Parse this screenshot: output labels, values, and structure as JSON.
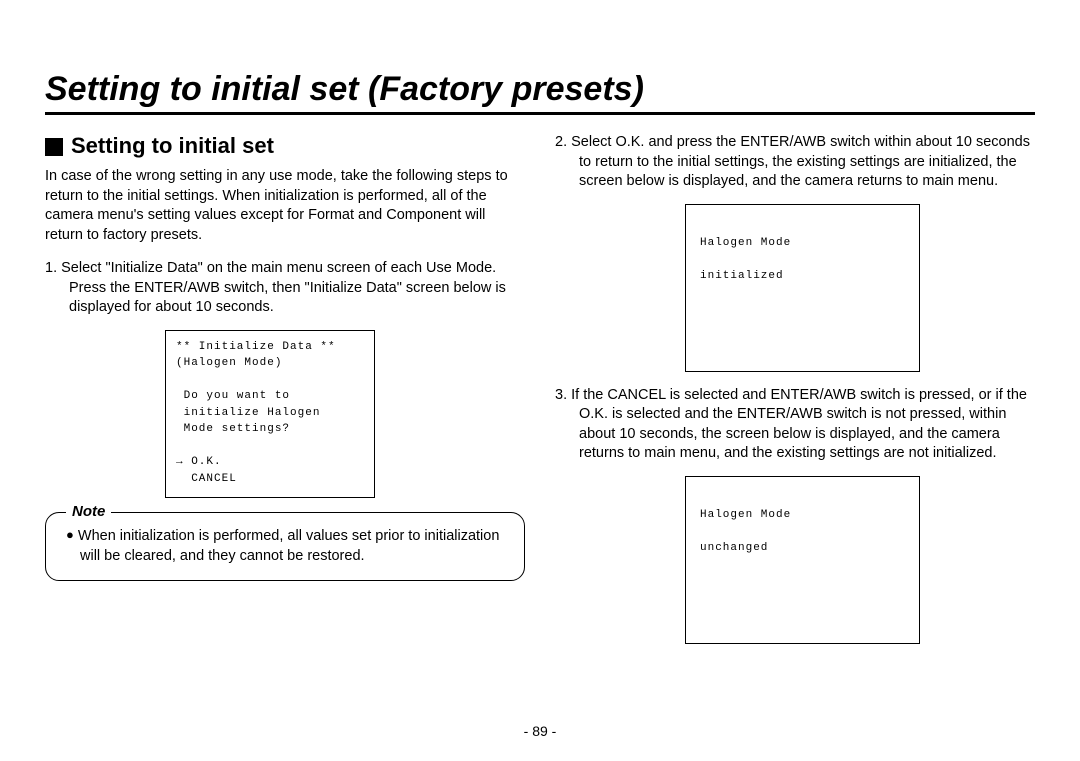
{
  "title": "Setting to initial set (Factory presets)",
  "left": {
    "heading": "Setting to initial set",
    "intro": "In case of the wrong setting in any use mode, take the following steps to return to the initial settings.\nWhen initialization is performed, all of the camera menu's setting values except for Format and Component will return to factory presets.",
    "step1_num": "1.",
    "step1": "Select \"Initialize Data\" on the main menu screen of each Use Mode.\nPress the ENTER/AWB switch, then \"Initialize Data\" screen below is displayed for about 10 seconds.",
    "screen1": "** Initialize Data **\n(Halogen Mode)\n\n Do you want to\n initialize Halogen\n Mode settings?\n\n→ O.K.\n  CANCEL",
    "note_label": "Note",
    "note_text": "When initialization is performed, all values set prior to initialization will be cleared, and they cannot be restored."
  },
  "right": {
    "step2_num": "2.",
    "step2": "Select O.K. and press the ENTER/AWB switch within about 10 seconds to return to the initial settings, the existing settings are initialized, the screen below is displayed, and the camera returns to main menu.",
    "screen2": "Halogen Mode\n\ninitialized",
    "step3_num": "3.",
    "step3": "If the CANCEL is selected and ENTER/AWB switch is pressed, or if the O.K. is selected and the ENTER/AWB switch is not pressed, within about 10 seconds, the screen below is displayed, and the camera returns to main menu, and the existing settings are not initialized.",
    "screen3": "Halogen Mode\n\nunchanged"
  },
  "page_number": "- 89 -"
}
